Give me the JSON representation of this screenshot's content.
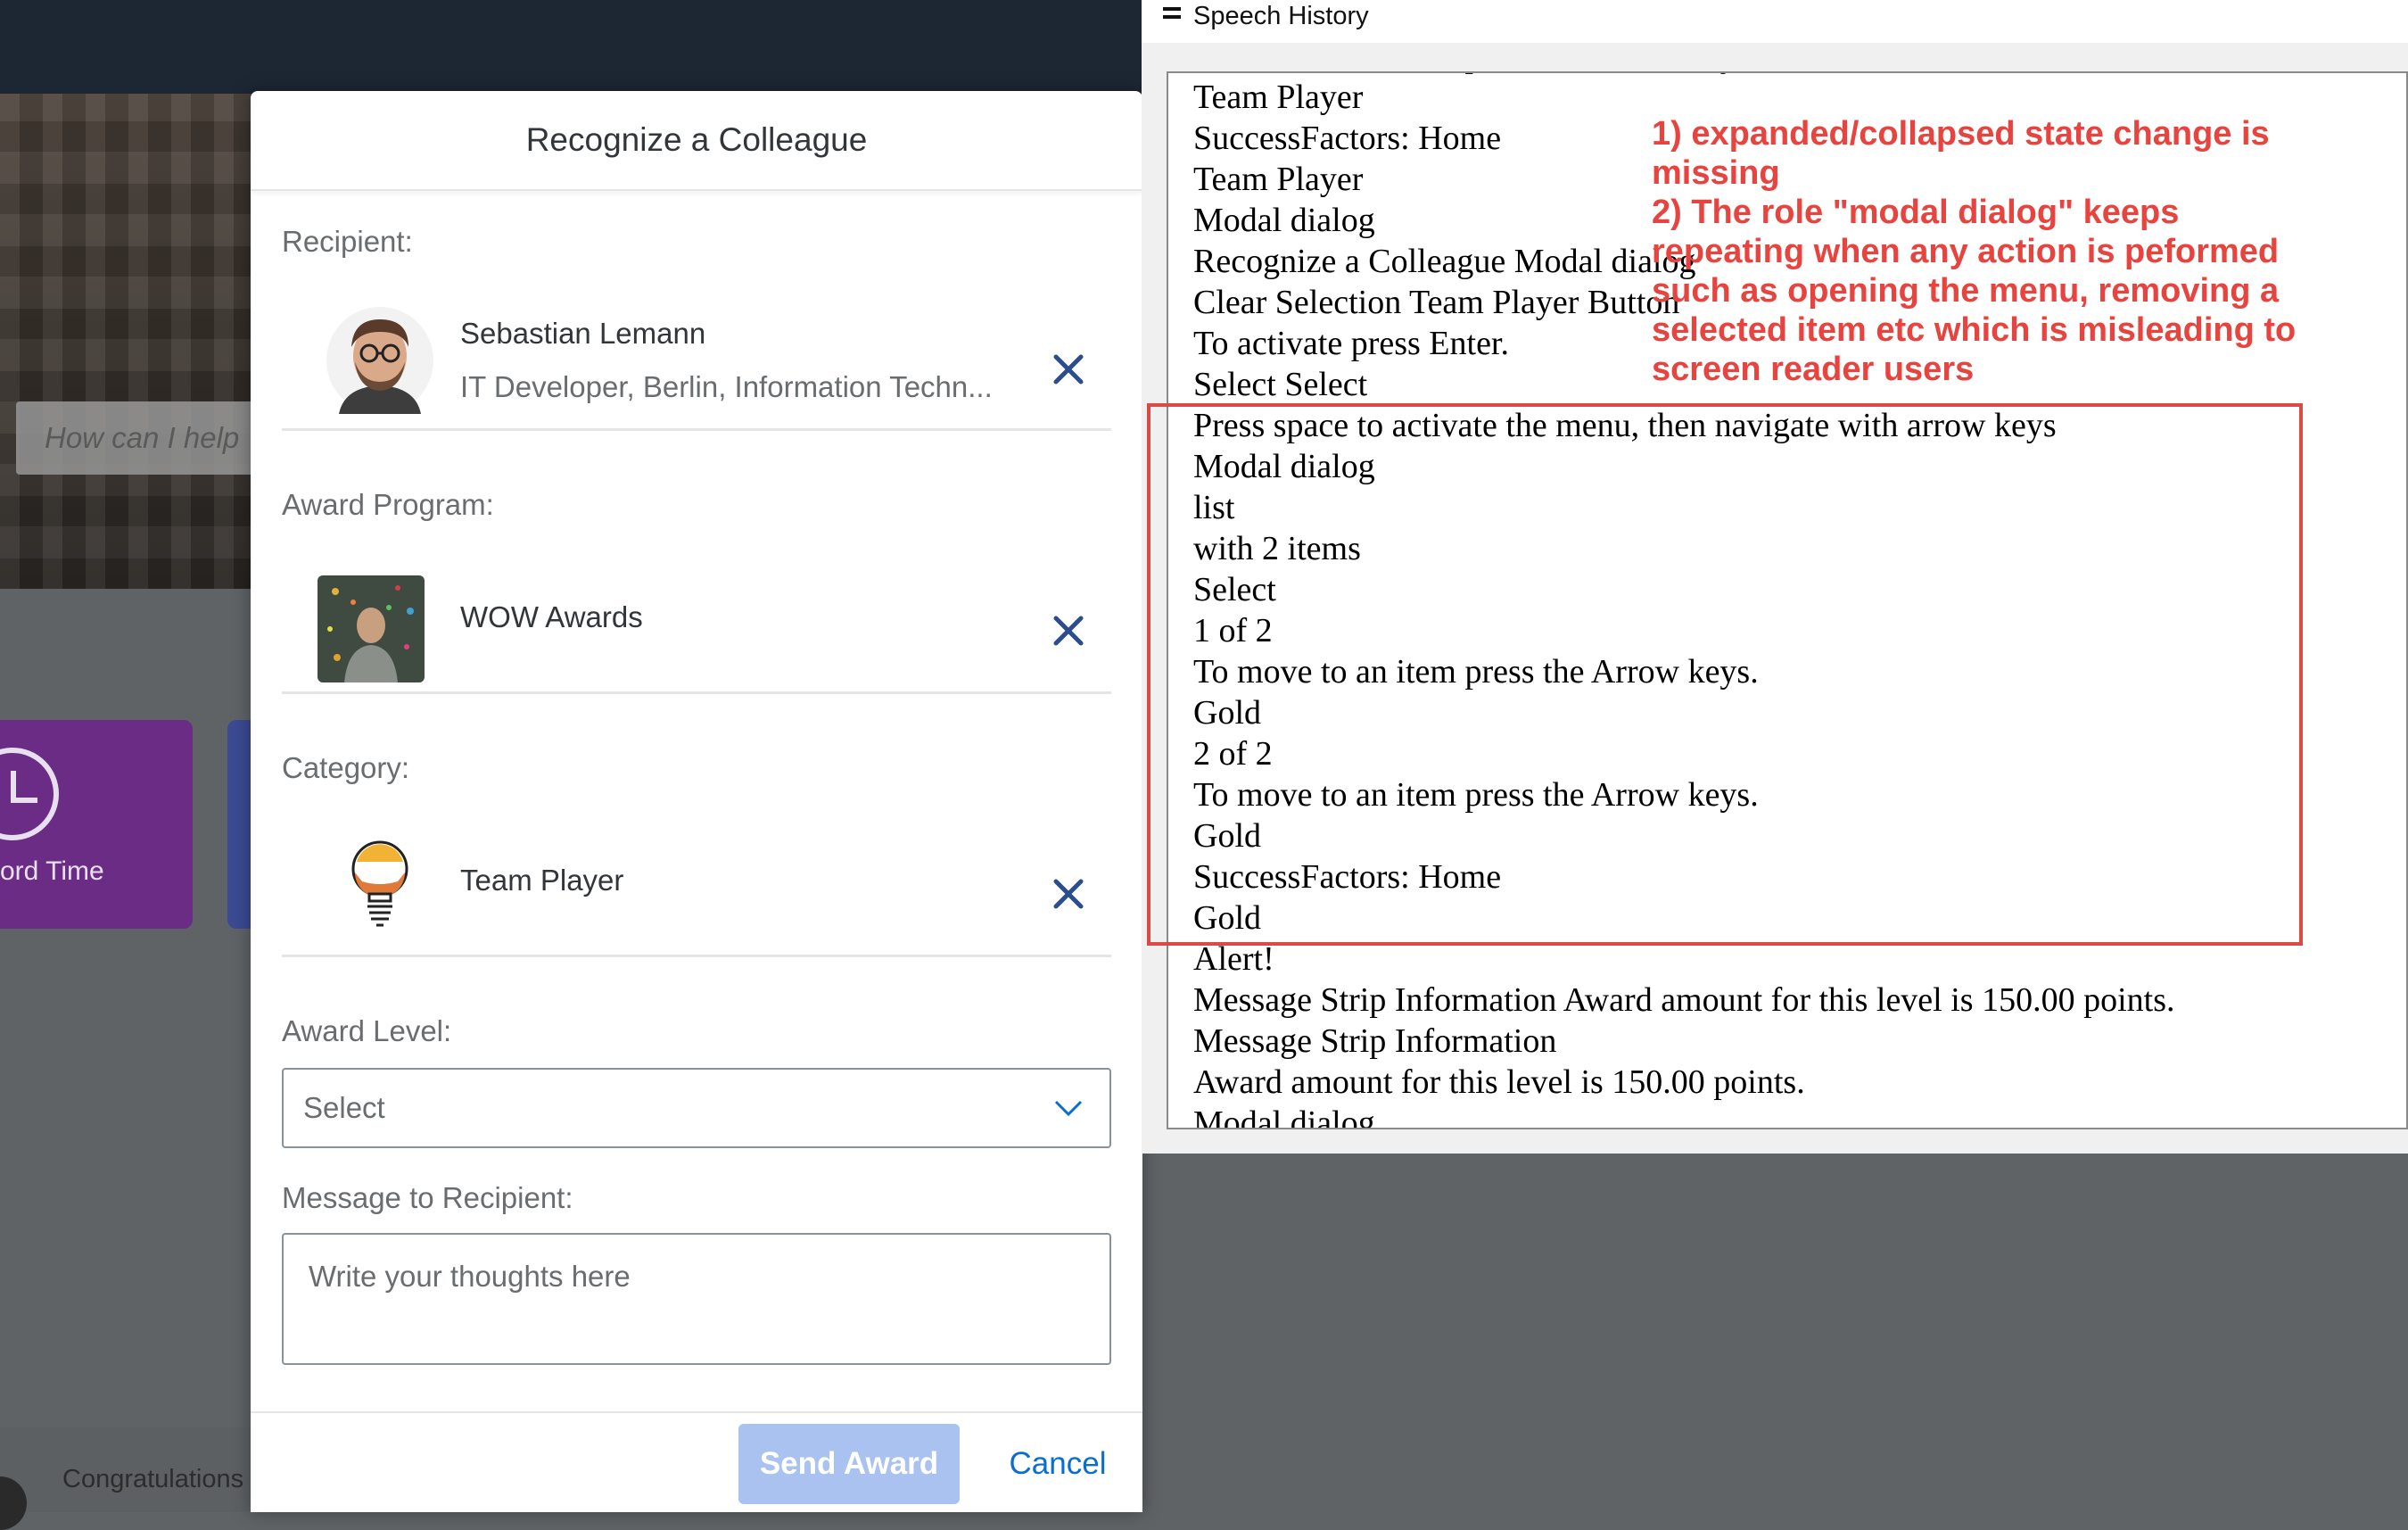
{
  "background_app": {
    "search_placeholder": "How can I help",
    "tile_label": "ord Time",
    "footer_text": "Congratulations"
  },
  "modal": {
    "title": "Recognize a Colleague",
    "recipient": {
      "label": "Recipient:",
      "name": "Sebastian Lemann",
      "subtitle": "IT Developer, Berlin, Information Techn..."
    },
    "award_program": {
      "label": "Award Program:",
      "name": "WOW Awards"
    },
    "category": {
      "label": "Category:",
      "name": "Team Player"
    },
    "award_level": {
      "label": "Award Level:",
      "value": "Select"
    },
    "message": {
      "label": "Message to Recipient:",
      "placeholder": "Write your thoughts here"
    },
    "send_label": "Send Award",
    "cancel_label": "Cancel",
    "colors": {
      "accent": "#0a6ed1",
      "send_disabled": "#a9c2ef",
      "clear_icon": "#2b4d8f"
    }
  },
  "speech_history": {
    "title": "Speech History",
    "lines": [
      "To move to an item press the Arrow keys.",
      "Team Player",
      "SuccessFactors: Home",
      "Team Player",
      "Modal dialog",
      "Recognize a Colleague Modal dialog",
      "Clear Selection Team Player Button",
      "To activate press Enter.",
      "Select Select",
      "Press space to activate the menu, then navigate with arrow keys",
      "Modal dialog",
      "list",
      "with 2 items",
      "Select",
      "1 of 2",
      "To move to an item press the Arrow keys.",
      "Gold",
      "2 of 2",
      "To move to an item press the Arrow keys.",
      "Gold",
      "SuccessFactors: Home",
      "Gold",
      "Alert!",
      "Message Strip Information Award amount for this level is 150.00 points.",
      "Message Strip Information",
      "Award amount for this level is 150.00 points.",
      "Modal dialog"
    ]
  },
  "annotation": {
    "note_1": "1) expanded/collapsed state change is missing",
    "note_2": "2) The role \"modal dialog\" keeps repeating when any action is peformed such as opening the menu, removing a selected item etc which is misleading to screen reader users",
    "color": "#e8443f"
  }
}
